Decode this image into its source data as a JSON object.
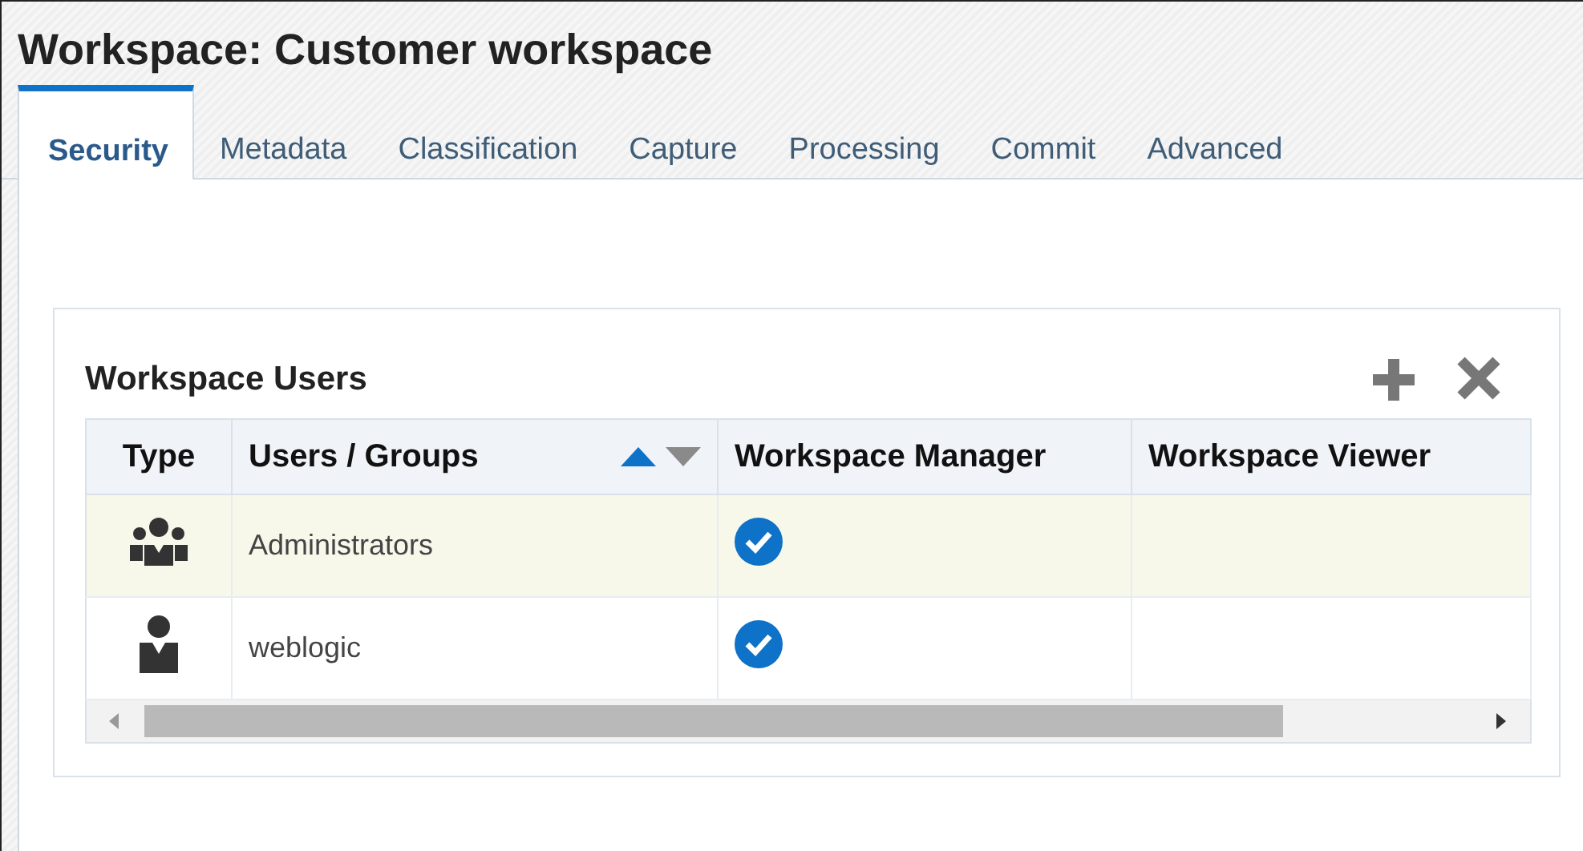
{
  "page_title": "Workspace: Customer workspace",
  "tabs": [
    {
      "label": "Security",
      "selected": true
    },
    {
      "label": "Metadata",
      "selected": false
    },
    {
      "label": "Classification",
      "selected": false
    },
    {
      "label": "Capture",
      "selected": false
    },
    {
      "label": "Processing",
      "selected": false
    },
    {
      "label": "Commit",
      "selected": false
    },
    {
      "label": "Advanced",
      "selected": false
    }
  ],
  "users_panel": {
    "title": "Workspace Users",
    "columns": [
      {
        "label": "Type",
        "kind": "plain"
      },
      {
        "label": "Users / Groups",
        "kind": "sortable",
        "sort_ascending": true
      },
      {
        "label": "Workspace Manager",
        "kind": "plain"
      },
      {
        "label": "Workspace Viewer",
        "kind": "plain"
      }
    ],
    "rows": [
      {
        "kind": "group",
        "name": "Administrators",
        "manager": true,
        "viewer": false,
        "selected": true
      },
      {
        "kind": "user",
        "name": "weblogic",
        "manager": true,
        "viewer": false,
        "selected": false
      }
    ]
  }
}
